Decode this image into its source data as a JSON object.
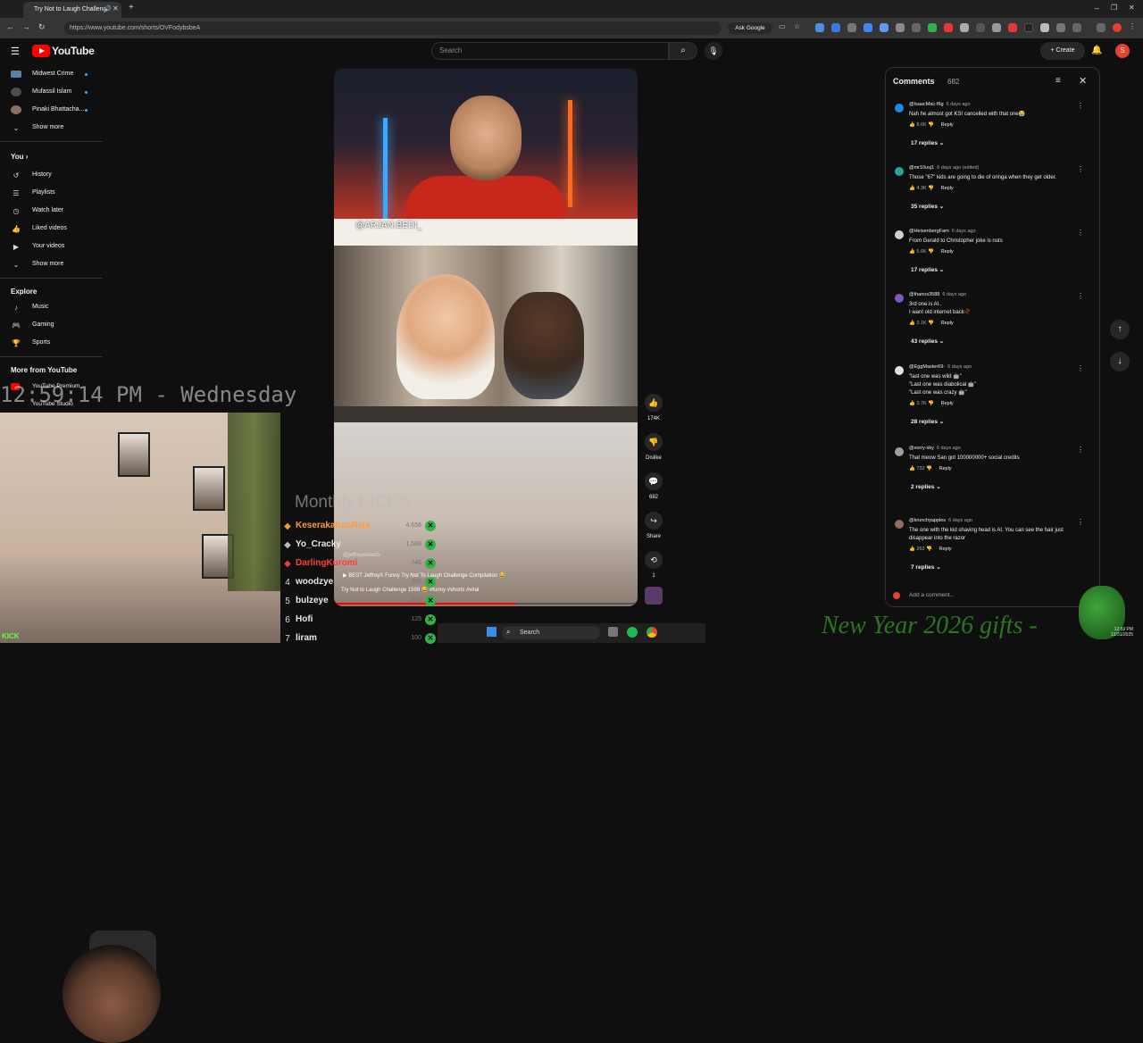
{
  "browser": {
    "tab_title": "Try Not to Laugh Challeng",
    "url": "https://www.youtube.com/shorts/OVFodybsbeA",
    "ask_google": "Ask Google"
  },
  "header": {
    "logo_text": "YouTube",
    "search_placeholder": "Search",
    "create_label": "Create",
    "avatar_letter": "S"
  },
  "sidebar": {
    "subscriptions": [
      {
        "label": "Midwest Crime"
      },
      {
        "label": "Mufassil Islam"
      },
      {
        "label": "Pinaki Bhattacha..."
      }
    ],
    "show_more_1": "Show more",
    "you_heading": "You",
    "you_items": [
      {
        "label": "History"
      },
      {
        "label": "Playlists"
      },
      {
        "label": "Watch later"
      },
      {
        "label": "Liked videos"
      },
      {
        "label": "Your videos"
      }
    ],
    "show_more_2": "Show more",
    "explore_heading": "Explore",
    "explore_items": [
      {
        "label": "Music"
      },
      {
        "label": "Gaming"
      },
      {
        "label": "Sports"
      }
    ],
    "more_heading": "More from YouTube",
    "more_items": [
      {
        "label": "YouTube Premium"
      },
      {
        "label": "YouTube Studio"
      }
    ]
  },
  "overlay": {
    "clock": "12:59:14 PM - Wednesday",
    "leaderboard_title": "Monthly KICK's",
    "leaderboard": [
      {
        "rank": "",
        "name": "KeserakahanRaja",
        "score": "4,656",
        "color": "#ff9a3c"
      },
      {
        "rank": "",
        "name": "Yo_Cracky",
        "score": "1,588",
        "color": "#e8e8e8"
      },
      {
        "rank": "",
        "name": "DarlingKuromi",
        "score": "746",
        "color": "#ff3b3b"
      },
      {
        "rank": "4",
        "name": "woodzye",
        "score": "398",
        "color": "#e8e8e8"
      },
      {
        "rank": "5",
        "name": "bulzeye",
        "score": "228",
        "color": "#e8e8e8"
      },
      {
        "rank": "6",
        "name": "Hofi",
        "score": "125",
        "color": "#e8e8e8"
      },
      {
        "rank": "7",
        "name": "liram",
        "score": "100",
        "color": "#e8e8e8"
      }
    ],
    "new_year_text": "New Year 2026 gifts -",
    "kick_watermark": "KICK"
  },
  "video": {
    "handle": "@ARJAN.BEDI_",
    "channel": "@jeffreyxreacts",
    "title_line1": "BEST JeffreyX Funny Try Not To Laugh Challenge Compilation 😂",
    "title_line2": "Try Not to Laugh Challenge 1599 😂 #funny #shorts #viral",
    "progress": 0.6
  },
  "actions": {
    "like_count": "174K",
    "dislike_label": "Dislike",
    "comment_count": "682",
    "share_label": "Share",
    "remix_count": "1"
  },
  "comments": {
    "title": "Comments",
    "count": "682",
    "add_placeholder": "Add a comment...",
    "items": [
      {
        "user": "@IsaacMac-f6g",
        "time": "6 days ago",
        "text": "Nah he almost got KSI cancelled with that one😭",
        "likes": "8.6K",
        "replies": "17 replies",
        "avatar_color": "#1e88e5"
      },
      {
        "user": "@mr10usj1",
        "time": "6 days ago (edited)",
        "text": "Those \"67\" kids are going to die of oringa when they get older.",
        "likes": "4.3K",
        "replies": "35 replies",
        "avatar_color": "#26a69a"
      },
      {
        "user": "@HeisenbergFam",
        "time": "6 days ago",
        "text": "From Gerald to Christopher joke is nuts",
        "likes": "5.6K",
        "replies": "17 replies",
        "avatar_color": "#cfcfcf"
      },
      {
        "user": "@thanos3588",
        "time": "6 days ago",
        "text": "3rd one is AI..\nI want old internet back🥀",
        "likes": "3.1K",
        "replies": "43 replies",
        "avatar_color": "#7e57c2"
      },
      {
        "user": "@EggMaster69-",
        "time": "6 days ago",
        "text": "\"last one was wild 🤖\"\n\"Last one was diabolical 🤖\"\n\"Last one was crazy 🤖\"",
        "likes": "3.7K",
        "replies": "28 replies",
        "avatar_color": "#e0e0e0"
      },
      {
        "user": "@sorry-sky",
        "time": "6 days ago",
        "text": "That meow San got 100000000+ social credits",
        "likes": "732",
        "replies": "2 replies",
        "avatar_color": "#9e9e9e"
      },
      {
        "user": "@krunchyapples",
        "time": "6 days ago",
        "text": "The one with the kid shaving head is AI. You can see the hair just\ndisappear into the razor",
        "likes": "263",
        "replies": "7 replies",
        "avatar_color": "#8d6e63"
      }
    ],
    "reply_label": "Reply"
  },
  "taskbar": {
    "search_label": "Search",
    "time": "12:59 PM",
    "date": "12/31/2025"
  }
}
